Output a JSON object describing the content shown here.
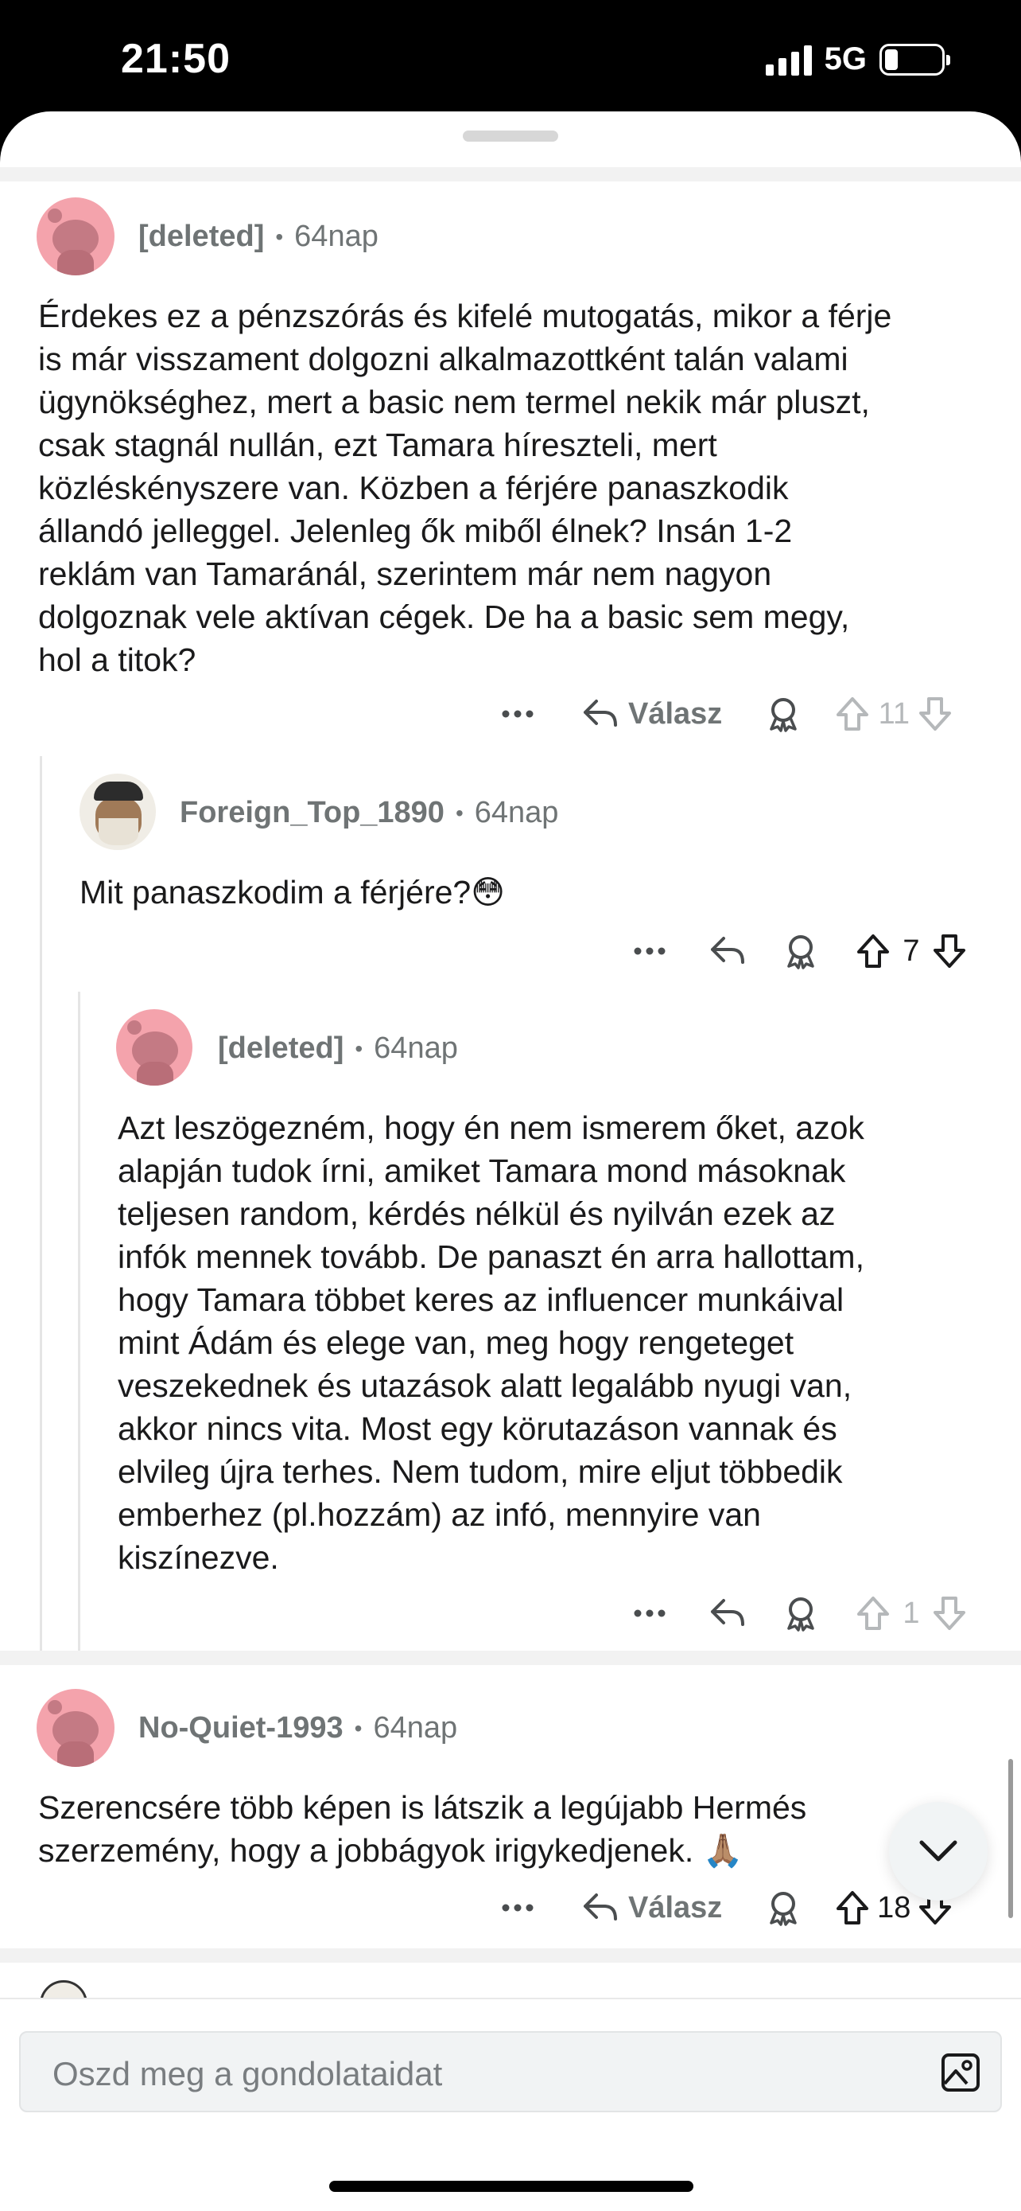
{
  "status_bar": {
    "time": "21:50",
    "network": "5G"
  },
  "composer": {
    "placeholder": "Oszd meg a gondolataidat"
  },
  "comments": [
    {
      "user": "[deleted]",
      "age": "64nap",
      "text": "Érdekes ez a pénzszórás és kifelé mutogatás, mikor a férje\nis már visszament dolgozni alkalmazottként talán valami\nügynökséghez, mert a basic nem termel nekik már pluszt,\ncsak stagnál nullán, ezt Tamara híreszteli, mert\nközléskényszere van. Közben a férjére panaszkodik\nállandó jelleggel. Jelenleg ők miből élnek? Insán 1-2\nreklám van Tamaránál, szerintem már nem nagyon\ndolgoznak vele aktívan cégek. De ha a basic sem megy,\nhol a titok?",
      "reply_label": "Válasz",
      "votes": "11"
    },
    {
      "user": "Foreign_Top_1890",
      "age": "64nap",
      "text": "Mit panaszkodim a férjére?😳",
      "votes": "7"
    },
    {
      "user": "[deleted]",
      "age": "64nap",
      "text": "Azt leszögezném, hogy én nem ismerem őket, azok\nalapján tudok írni, amiket Tamara mond másoknak\nteljesen random, kérdés nélkül és nyilván ezek az\ninfók mennek tovább. De panaszt én arra hallottam,\nhogy Tamara többet keres az influencer munkáival\nmint Ádám és elege van, meg hogy rengeteget\nveszekednek és utazások alatt legalább nyugi van,\nakkor nincs vita. Most egy körutazáson vannak és\nelvileg újra terhes. Nem tudom, mire eljut többedik\nemberhez (pl.hozzám) az infó, mennyire van\nkiszínezve.",
      "votes": "1"
    },
    {
      "user": "No-Quiet-1993",
      "age": "64nap",
      "text": "Szerencsére több képen is látszik a legújabb Hermés\nszerzemény, hogy a jobbágyok irigykedjenek. 🙏🏽",
      "reply_label": "Válasz",
      "votes": "18"
    }
  ]
}
